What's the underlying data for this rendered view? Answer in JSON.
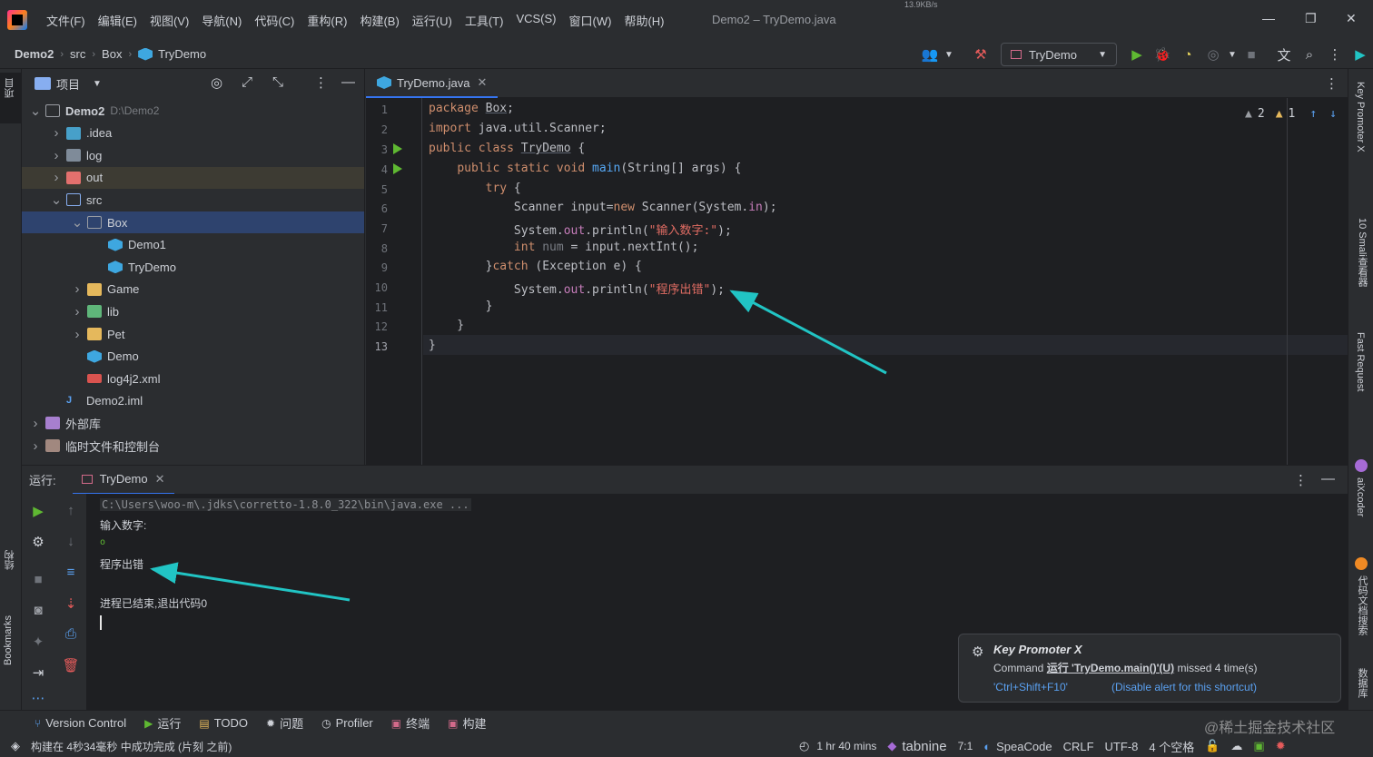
{
  "menubar": {
    "items": [
      "文件(F)",
      "编辑(E)",
      "视图(V)",
      "导航(N)",
      "代码(C)",
      "重构(R)",
      "构建(B)",
      "运行(U)",
      "工具(T)",
      "VCS(S)",
      "窗口(W)",
      "帮助(H)"
    ],
    "window_title": "Demo2 – TryDemo.java",
    "net_speed": "13.9KB/s"
  },
  "navbar": {
    "breadcrumbs": [
      "Demo2",
      "src",
      "Box",
      "TryDemo"
    ],
    "run_config": "TryDemo"
  },
  "project": {
    "title": "项目",
    "tree": [
      {
        "label": "Demo2",
        "sub": "D:\\Demo2",
        "chev": "open",
        "level": 0,
        "icon": "folder"
      },
      {
        "label": ".idea",
        "chev": "closed",
        "level": 1,
        "icon": "folder-idea"
      },
      {
        "label": "log",
        "chev": "closed",
        "level": 1,
        "icon": "folder-gray"
      },
      {
        "label": "out",
        "chev": "closed",
        "level": 1,
        "icon": "folder-r",
        "row": "hl"
      },
      {
        "label": "src",
        "chev": "open",
        "level": 1,
        "icon": "folder-blue"
      },
      {
        "label": "Box",
        "chev": "open",
        "level": 2,
        "icon": "folder",
        "row": "sel"
      },
      {
        "label": "Demo1",
        "chev": "",
        "level": 3,
        "icon": "class"
      },
      {
        "label": "TryDemo",
        "chev": "",
        "level": 3,
        "icon": "class"
      },
      {
        "label": "Game",
        "chev": "closed",
        "level": 2,
        "icon": "folder-y"
      },
      {
        "label": "lib",
        "chev": "closed",
        "level": 2,
        "icon": "folder-g"
      },
      {
        "label": "Pet",
        "chev": "closed",
        "level": 2,
        "icon": "folder-y"
      },
      {
        "label": "Demo",
        "chev": "",
        "level": 2,
        "icon": "class"
      },
      {
        "label": "log4j2.xml",
        "chev": "",
        "level": 2,
        "icon": "xml"
      },
      {
        "label": "Demo2.iml",
        "chev": "",
        "level": 1,
        "icon": "iml"
      },
      {
        "label": "外部库",
        "chev": "closed",
        "level": 0,
        "icon": "lib"
      },
      {
        "label": "临时文件和控制台",
        "chev": "closed",
        "level": 0,
        "icon": "scratch"
      }
    ]
  },
  "editor": {
    "tab_label": "TryDemo.java",
    "warnings": "2",
    "weak_warnings": "1",
    "line_numbers": [
      "1",
      "2",
      "3",
      "4",
      "5",
      "6",
      "7",
      "8",
      "9",
      "10",
      "11",
      "12",
      "13"
    ]
  },
  "run": {
    "label": "运行:",
    "tab": "TryDemo",
    "console": [
      "C:\\Users\\woo-m\\.jdks\\corretto-1.8.0_322\\bin\\java.exe ...",
      "输入数字:",
      "o",
      "程序出错",
      "",
      "进程已结束,退出代码0"
    ]
  },
  "notification": {
    "title": "Key Promoter X",
    "msg_prefix": "Command",
    "msg_cmd": "运行 'TryDemo.main()'(U)",
    "msg_suffix": "missed 4 time(s)",
    "shortcut": "'Ctrl+Shift+F10'",
    "disable": "(Disable alert for this shortcut)"
  },
  "tools": {
    "items": [
      "Version Control",
      "运行",
      "TODO",
      "问题",
      "Profiler",
      "终端",
      "构建"
    ]
  },
  "status": {
    "message": "构建在 4秒34毫秒 中成功完成 (片刻 之前)",
    "time": "1 hr 40 mins",
    "tabnine": "tabnine",
    "pos": "7:1",
    "speacode": "SpeaCode",
    "crlf": "CRLF",
    "enc": "UTF-8",
    "indent": "4 个空格",
    "watermark": "@稀土掘金技术社区"
  },
  "left_stripe": {
    "project": "项目",
    "structure": "结构",
    "bookmarks": "Bookmarks"
  },
  "right_stripe": {
    "keypromoter": "Key Promoter X",
    "smali": "10 Smali查看器",
    "fastreq": "Fast Request",
    "aix": "aiXcoder",
    "doc": "代码文档搜索",
    "db": "数据库"
  },
  "colors": {
    "accent": "#3574f0",
    "arrow": "#21c4c4",
    "run_green": "#5fb832"
  }
}
